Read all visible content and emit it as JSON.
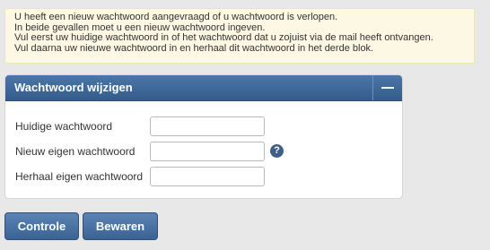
{
  "notice": {
    "lines": [
      "U heeft een nieuw wachtwoord aangevraagd of u wachtwoord is verlopen.",
      "In beide gevallen moet u een nieuw wachtwoord ingeven.",
      "Vul eerst uw huidige wachtwoord in of het wachtwoord dat u zojuist via de mail heeft ontvangen.",
      "Vul daarna uw nieuwe wachtwoord in en herhaal dit wachtwoord in het derde blok."
    ]
  },
  "panel": {
    "title": "Wachtwoord wijzigen",
    "collapse_icon": "minus-icon",
    "fields": [
      {
        "label": "Huidige wachtwoord",
        "value": ""
      },
      {
        "label": "Nieuw eigen wachtwoord",
        "value": "",
        "help_icon": "question-icon",
        "help_glyph": "?"
      },
      {
        "label": "Herhaal eigen wachtwoord",
        "value": ""
      }
    ]
  },
  "buttons": {
    "check_label": "Controle",
    "save_label": "Bewaren"
  },
  "colors": {
    "header_bg": "#3f6897",
    "notice_bg": "#fcf8e3",
    "page_bg": "#e8e8e8",
    "button_bg": "#4a74a5"
  }
}
